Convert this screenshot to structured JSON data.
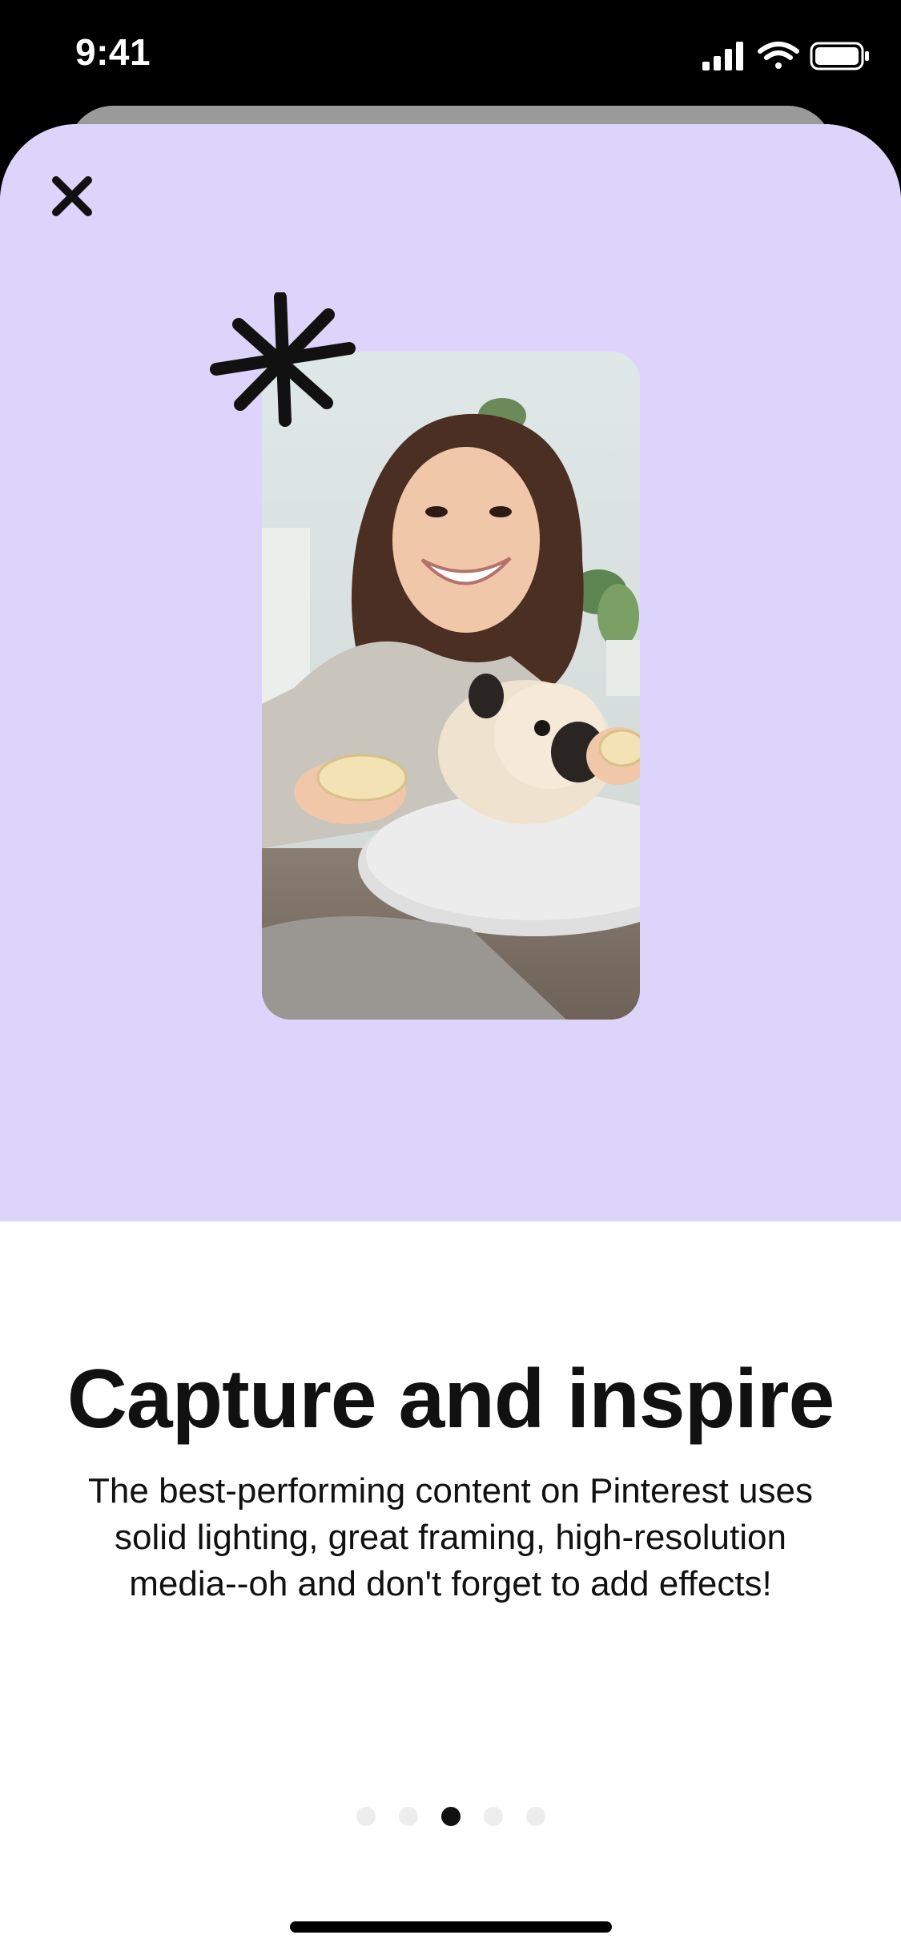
{
  "status_bar": {
    "time": "9:41",
    "icons": [
      "cellular-signal-icon",
      "wifi-icon",
      "battery-icon"
    ]
  },
  "onboarding": {
    "close_icon": "close-icon",
    "title": "Capture and inspire",
    "body": "The best-performing content on Pinterest uses solid lighting, great framing, high-resolution media--oh and don't forget to add effects!",
    "hero_background": "#dcd4fb",
    "page_indicator": {
      "total": 5,
      "current": 3
    }
  }
}
